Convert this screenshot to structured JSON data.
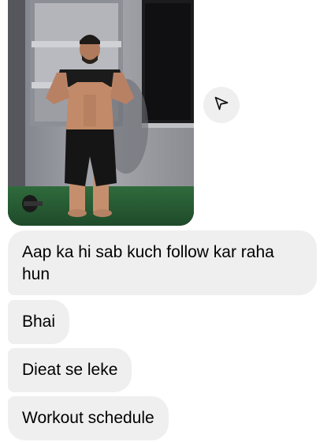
{
  "chat": {
    "messages": [
      {
        "text": "Aap ka hi sab kuch follow kar raha hun"
      },
      {
        "text": "Bhai"
      },
      {
        "text": "Dieat se leke"
      },
      {
        "text": "Workout schedule"
      }
    ],
    "share_icon": "paper-plane-icon"
  },
  "colors": {
    "bubble_bg": "#efefef",
    "text": "#000000",
    "background": "#ffffff"
  }
}
